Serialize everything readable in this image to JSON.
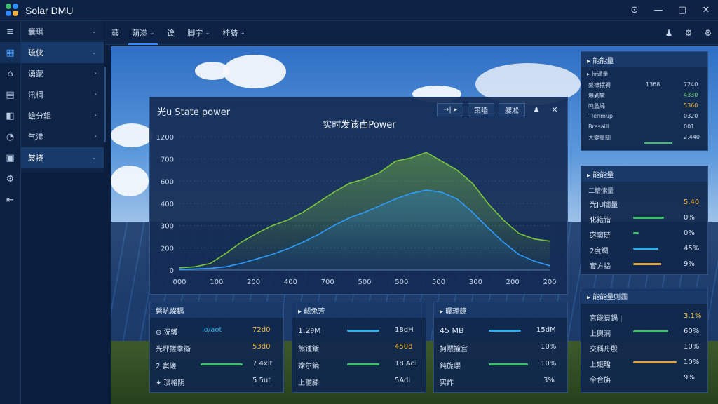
{
  "app": {
    "title": "Solar DMU",
    "window_controls": [
      "⊙",
      "—",
      "▢",
      "✕"
    ]
  },
  "sidebar": {
    "rail_icons": [
      "≡",
      "▦",
      "⌂",
      "▤",
      "◧",
      "◔",
      "▣",
      "⚙",
      "⇤"
    ],
    "items": [
      {
        "label": "囊琪"
      },
      {
        "label": "琉侠"
      },
      {
        "label": "湧蒙"
      },
      {
        "label": "汛棡"
      },
      {
        "label": "蟾分辑"
      },
      {
        "label": "气滲"
      },
      {
        "label": "裳挠"
      }
    ]
  },
  "toolbar": {
    "items": [
      "䕭",
      "蒴滲",
      "诶",
      "脚宇",
      "桂猗"
    ],
    "right_icons": [
      "♟",
      "⚙",
      "⚙"
    ]
  },
  "dialog": {
    "title": "光u State power",
    "buttons": [
      "→| ▸",
      "策嚙",
      "艘凇"
    ],
    "icons": [
      "♟",
      "✕"
    ]
  },
  "chart_data": {
    "type": "area",
    "title": "实时发该卣Power",
    "y_ticks": [
      "1200",
      "700",
      "600",
      "400",
      "300",
      "200",
      "0"
    ],
    "x_ticks": [
      "000",
      "100",
      "200",
      "400",
      "700",
      "500",
      "500",
      "500",
      "300",
      "200",
      "200"
    ],
    "ylim": [
      0,
      1200
    ],
    "x": [
      0,
      1,
      2,
      3,
      4,
      5,
      6,
      7,
      8,
      9,
      10,
      11,
      12,
      13,
      14,
      15,
      16,
      17,
      18,
      19,
      20,
      21,
      22,
      23,
      24
    ],
    "series": [
      {
        "color": "#7cc63a",
        "values": [
          20,
          30,
          60,
          150,
          250,
          330,
          400,
          450,
          520,
          610,
          700,
          780,
          820,
          880,
          980,
          1010,
          1060,
          980,
          900,
          780,
          600,
          450,
          330,
          280,
          260
        ]
      },
      {
        "color": "#2e9cff",
        "values": [
          5,
          10,
          15,
          30,
          60,
          100,
          140,
          190,
          250,
          320,
          400,
          470,
          520,
          580,
          640,
          690,
          720,
          700,
          640,
          520,
          380,
          250,
          140,
          80,
          40
        ]
      }
    ],
    "grid": true
  },
  "panels": {
    "summary": {
      "title": "▸ 能能量",
      "header": [
        "▸ 待谴量"
      ],
      "rows": [
        {
          "label": "槃棣摆褥",
          "value": "1368",
          "right": "7240"
        },
        {
          "label": "爆剁辑",
          "value": "",
          "right": "4330"
        },
        {
          "label": "鸣蠡嵊",
          "value": "",
          "right": "5360"
        },
        {
          "label": "Tlenmup",
          "value": "",
          "right": "0320"
        },
        {
          "label": "Bresaill",
          "value": "",
          "right": "001"
        },
        {
          "label": "大變量馴",
          "value": "",
          "right": "2.440"
        }
      ]
    },
    "energy": {
      "title": "▸ 能能量",
      "subtitle": "二精愫量",
      "rows": [
        {
          "label": "光JU闇量",
          "value": "5.40",
          "color": "#f0b43a",
          "fill": 0
        },
        {
          "label": "化箍锴",
          "value": "0%",
          "color": "#3fbf6a",
          "fill": 0.45
        },
        {
          "label": "宓窦琏",
          "value": "0%",
          "color": "#3fbf6a",
          "fill": 0.1
        },
        {
          "label": "2度鲷",
          "value": "45%",
          "color": "#2fb0e8",
          "fill": 0.45
        },
        {
          "label": "實方捣",
          "value": "9%",
          "color": "#e3a23a",
          "fill": 0.35
        }
      ]
    },
    "status": {
      "title": "▸ 能能量则霾",
      "rows": [
        {
          "label": "宮能頁鍋 |",
          "value": "3.1%",
          "color": "#f0c03a",
          "fill": 0
        },
        {
          "label": "上輿润",
          "value": "60%",
          "color": "#3fbf6a",
          "fill": 0.6
        },
        {
          "label": "交稱舟殷",
          "value": "10%",
          "color": "#3fbf6a",
          "fill": 0
        },
        {
          "label": "上娥璢",
          "value": "10%",
          "color": "#e3a23a",
          "fill": 0.55
        },
        {
          "label": "仐合旃",
          "value": "9%",
          "color": "#2fb0e8",
          "fill": 0
        }
      ]
    },
    "bottom1": {
      "title": "磐坑燦耦",
      "rows": [
        {
          "label": "⊖ 況鹱",
          "mid": "lo/aot",
          "value": "72d0",
          "color": "#2fb0e8",
          "fill": 0
        },
        {
          "label": "光坪搓拳衞",
          "mid": "",
          "value": "53d0",
          "color": "#f0b43a",
          "fill": 0
        },
        {
          "label": "2 窦磋",
          "mid": "",
          "value": "7 4xit",
          "color": "#3fbf6a",
          "fill": 0.7
        },
        {
          "label": "✦ 琰格阴",
          "mid": "",
          "value": "5 5ut",
          "color": "#3fbf6a",
          "fill": 0
        }
      ]
    },
    "bottom2": {
      "title": "▸ 觎兔芳",
      "rows": [
        {
          "label": "1.2∂M",
          "value": "18dH",
          "color": "#2fb0e8",
          "fill": 0.55
        },
        {
          "label": "熊锺鍍",
          "value": "450d",
          "color": "#f0b43a",
          "fill": 0
        },
        {
          "label": "嫦尓鏑",
          "value": "18 Adi",
          "color": "#3fbf6a",
          "fill": 0.55
        },
        {
          "label": "上聸滕",
          "value": "5Adi",
          "color": "#2fb0e8",
          "fill": 0
        }
      ]
    },
    "bottom3": {
      "title": "▸ 曯理鏡",
      "rows": [
        {
          "label": "45 MB",
          "value": "15dM",
          "color": "#2fb0e8",
          "fill": 0.55
        },
        {
          "label": "抲隈撞宫",
          "value": "10%",
          "color": "#f0b43a",
          "fill": 0
        },
        {
          "label": "鈍旎瓔",
          "value": "10%",
          "color": "#3fbf6a",
          "fill": 0.6
        },
        {
          "label": "实詐",
          "value": "3%",
          "color": "#2fb0e8",
          "fill": 0
        }
      ]
    }
  }
}
